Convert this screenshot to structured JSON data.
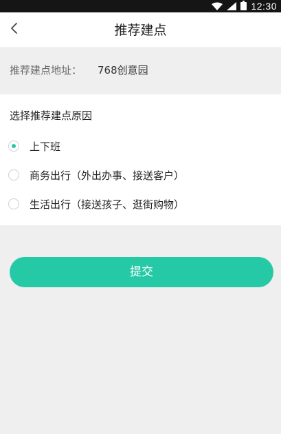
{
  "status_bar": {
    "time": "12:30",
    "icons": [
      "wifi-icon",
      "signal-icon",
      "battery-icon"
    ]
  },
  "header": {
    "title": "推荐建点",
    "back_icon": "chevron-left-icon"
  },
  "address": {
    "label": "推荐建点地址：",
    "value": "768创意园"
  },
  "reasons": {
    "title": "选择推荐建点原因",
    "options": [
      {
        "label": "上下班",
        "selected": true
      },
      {
        "label": "商务出行（外出办事、接送客户）",
        "selected": false
      },
      {
        "label": "生活出行（接送孩子、逛街购物）",
        "selected": false
      }
    ]
  },
  "submit": {
    "label": "提交"
  },
  "colors": {
    "accent": "#26c9a6",
    "background": "#efefef",
    "card": "#ffffff",
    "status_bar": "#151515"
  }
}
